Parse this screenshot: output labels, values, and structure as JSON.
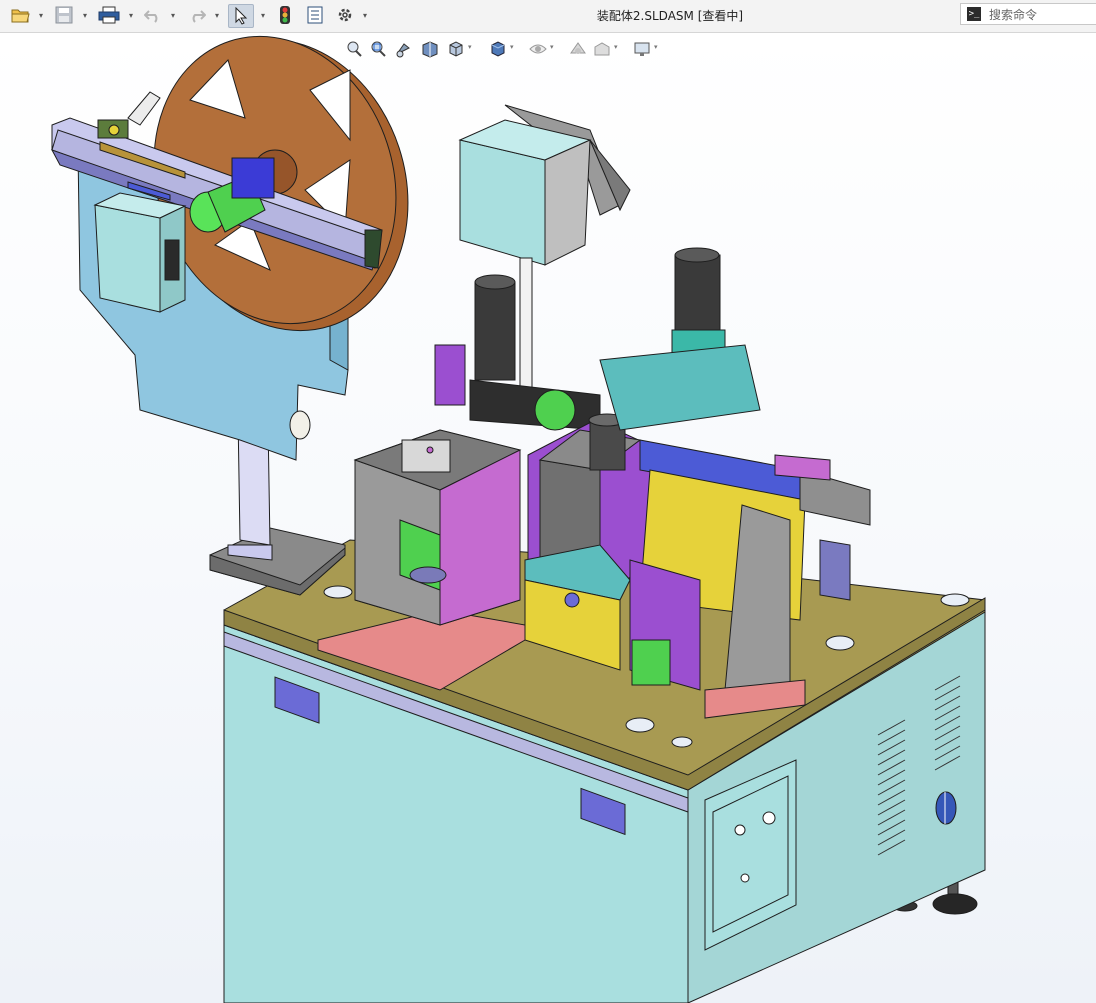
{
  "window": {
    "title": "装配体2.SLDASM [查看中]"
  },
  "toolbar": {
    "buttons": [
      {
        "name": "open",
        "icon": "open-folder-icon"
      },
      {
        "name": "save",
        "icon": "save-icon"
      },
      {
        "name": "print",
        "icon": "print-icon"
      },
      {
        "name": "undo",
        "icon": "undo-icon"
      },
      {
        "name": "redo",
        "icon": "redo-icon"
      },
      {
        "name": "select",
        "icon": "cursor-arrow-icon",
        "active": true
      },
      {
        "name": "rebuild",
        "icon": "traffic-light-icon"
      },
      {
        "name": "file-properties",
        "icon": "properties-icon"
      },
      {
        "name": "options",
        "icon": "gear-icon"
      }
    ]
  },
  "search": {
    "placeholder": "搜索命令",
    "icon": "command-prompt-icon"
  },
  "heads_up_toolbar": {
    "buttons": [
      {
        "icon": "zoom-to-fit-icon"
      },
      {
        "icon": "zoom-area-icon"
      },
      {
        "icon": "previous-view-icon"
      },
      {
        "icon": "section-view-icon"
      },
      {
        "icon": "view-orientation-icon"
      },
      {
        "icon": "display-style-icon"
      },
      {
        "icon": "hide-show-items-icon"
      },
      {
        "icon": "edit-appearance-icon"
      },
      {
        "icon": "apply-scene-icon"
      },
      {
        "icon": "view-settings-icon"
      }
    ]
  },
  "colors": {
    "cabinet": "#a7dede",
    "cabinet_dark": "#8fc8c8",
    "tabletop": "#a89a52",
    "reel": "#b36f3a",
    "panel_blue": "#8fc6e0",
    "frame_lavender": "#c9c9ee",
    "accent_purple": "#9b4fd0",
    "accent_green": "#4fd04f",
    "accent_magenta": "#c56bd0",
    "accent_yellow": "#e6d23a",
    "accent_pink": "#e68a8a"
  }
}
